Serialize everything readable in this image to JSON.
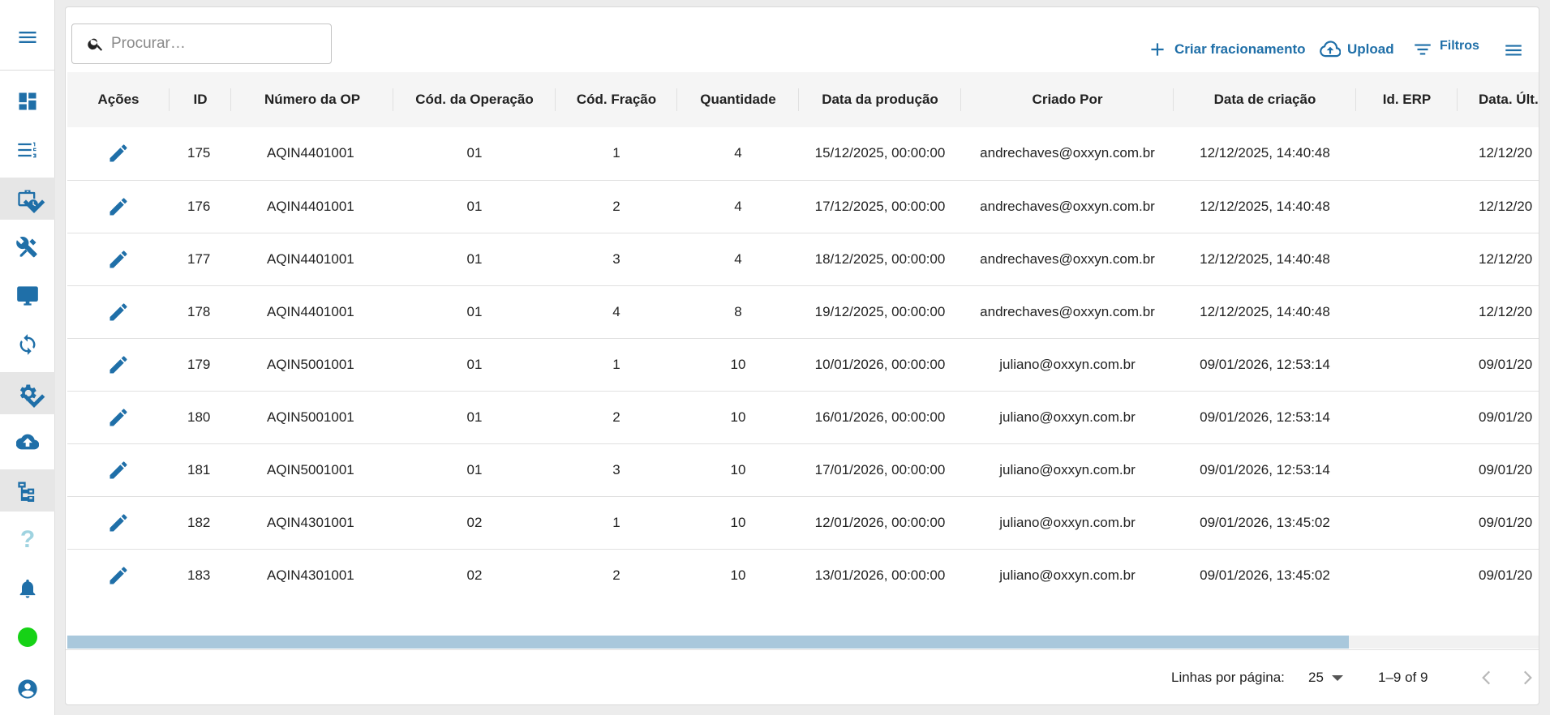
{
  "colors": {
    "accent": "#1f6fa8",
    "help": "#9fd3e0",
    "status_online": "#16d216",
    "scrollbar_thumb": "#a9c8dc"
  },
  "sidebar": {
    "items": [
      {
        "name": "menu-icon"
      },
      {
        "name": "dashboard-icon"
      },
      {
        "name": "numbered-list-icon"
      },
      {
        "name": "briefcase-clock-icon"
      },
      {
        "name": "tools-icon"
      },
      {
        "name": "monitor-icon"
      },
      {
        "name": "sync-icon"
      },
      {
        "name": "gear-icon"
      },
      {
        "name": "cloud-upload-icon"
      },
      {
        "name": "hierarchy-icon"
      },
      {
        "name": "help-icon",
        "text": "?"
      },
      {
        "name": "bell-icon"
      },
      {
        "name": "status-online-indicator"
      },
      {
        "name": "account-icon"
      }
    ]
  },
  "search": {
    "placeholder": "Procurar…"
  },
  "toolbar": {
    "create_label": "Criar fracionamento",
    "upload_label": "Upload",
    "filters_label": "Filtros"
  },
  "table": {
    "columns": [
      "Ações",
      "ID",
      "Número da OP",
      "Cód. da Operação",
      "Cód. Fração",
      "Quantidade",
      "Data da produção",
      "Criado Por",
      "Data de criação",
      "Id. ERP",
      "Data. Últ."
    ],
    "rows": [
      {
        "id": "175",
        "op": "AQIN4401001",
        "cod_op": "01",
        "cod_fracao": "1",
        "qtd": "4",
        "data_prod": "15/12/2025, 00:00:00",
        "criado_por": "andrechaves@oxxyn.com.br",
        "data_criacao": "12/12/2025, 14:40:48",
        "id_erp": "",
        "data_ult": "12/12/20"
      },
      {
        "id": "176",
        "op": "AQIN4401001",
        "cod_op": "01",
        "cod_fracao": "2",
        "qtd": "4",
        "data_prod": "17/12/2025, 00:00:00",
        "criado_por": "andrechaves@oxxyn.com.br",
        "data_criacao": "12/12/2025, 14:40:48",
        "id_erp": "",
        "data_ult": "12/12/20"
      },
      {
        "id": "177",
        "op": "AQIN4401001",
        "cod_op": "01",
        "cod_fracao": "3",
        "qtd": "4",
        "data_prod": "18/12/2025, 00:00:00",
        "criado_por": "andrechaves@oxxyn.com.br",
        "data_criacao": "12/12/2025, 14:40:48",
        "id_erp": "",
        "data_ult": "12/12/20"
      },
      {
        "id": "178",
        "op": "AQIN4401001",
        "cod_op": "01",
        "cod_fracao": "4",
        "qtd": "8",
        "data_prod": "19/12/2025, 00:00:00",
        "criado_por": "andrechaves@oxxyn.com.br",
        "data_criacao": "12/12/2025, 14:40:48",
        "id_erp": "",
        "data_ult": "12/12/20"
      },
      {
        "id": "179",
        "op": "AQIN5001001",
        "cod_op": "01",
        "cod_fracao": "1",
        "qtd": "10",
        "data_prod": "10/01/2026, 00:00:00",
        "criado_por": "juliano@oxxyn.com.br",
        "data_criacao": "09/01/2026, 12:53:14",
        "id_erp": "",
        "data_ult": "09/01/20"
      },
      {
        "id": "180",
        "op": "AQIN5001001",
        "cod_op": "01",
        "cod_fracao": "2",
        "qtd": "10",
        "data_prod": "16/01/2026, 00:00:00",
        "criado_por": "juliano@oxxyn.com.br",
        "data_criacao": "09/01/2026, 12:53:14",
        "id_erp": "",
        "data_ult": "09/01/20"
      },
      {
        "id": "181",
        "op": "AQIN5001001",
        "cod_op": "01",
        "cod_fracao": "3",
        "qtd": "10",
        "data_prod": "17/01/2026, 00:00:00",
        "criado_por": "juliano@oxxyn.com.br",
        "data_criacao": "09/01/2026, 12:53:14",
        "id_erp": "",
        "data_ult": "09/01/20"
      },
      {
        "id": "182",
        "op": "AQIN4301001",
        "cod_op": "02",
        "cod_fracao": "1",
        "qtd": "10",
        "data_prod": "12/01/2026, 00:00:00",
        "criado_por": "juliano@oxxyn.com.br",
        "data_criacao": "09/01/2026, 13:45:02",
        "id_erp": "",
        "data_ult": "09/01/20"
      },
      {
        "id": "183",
        "op": "AQIN4301001",
        "cod_op": "02",
        "cod_fracao": "2",
        "qtd": "10",
        "data_prod": "13/01/2026, 00:00:00",
        "criado_por": "juliano@oxxyn.com.br",
        "data_criacao": "09/01/2026, 13:45:02",
        "id_erp": "",
        "data_ult": "09/01/20"
      }
    ]
  },
  "scrollbar": {
    "position_fraction": 0.0,
    "visible_fraction": 0.87
  },
  "pagination": {
    "rows_per_page_label": "Linhas por página:",
    "rows_per_page_value": "25",
    "range_label": "1–9 of 9"
  }
}
